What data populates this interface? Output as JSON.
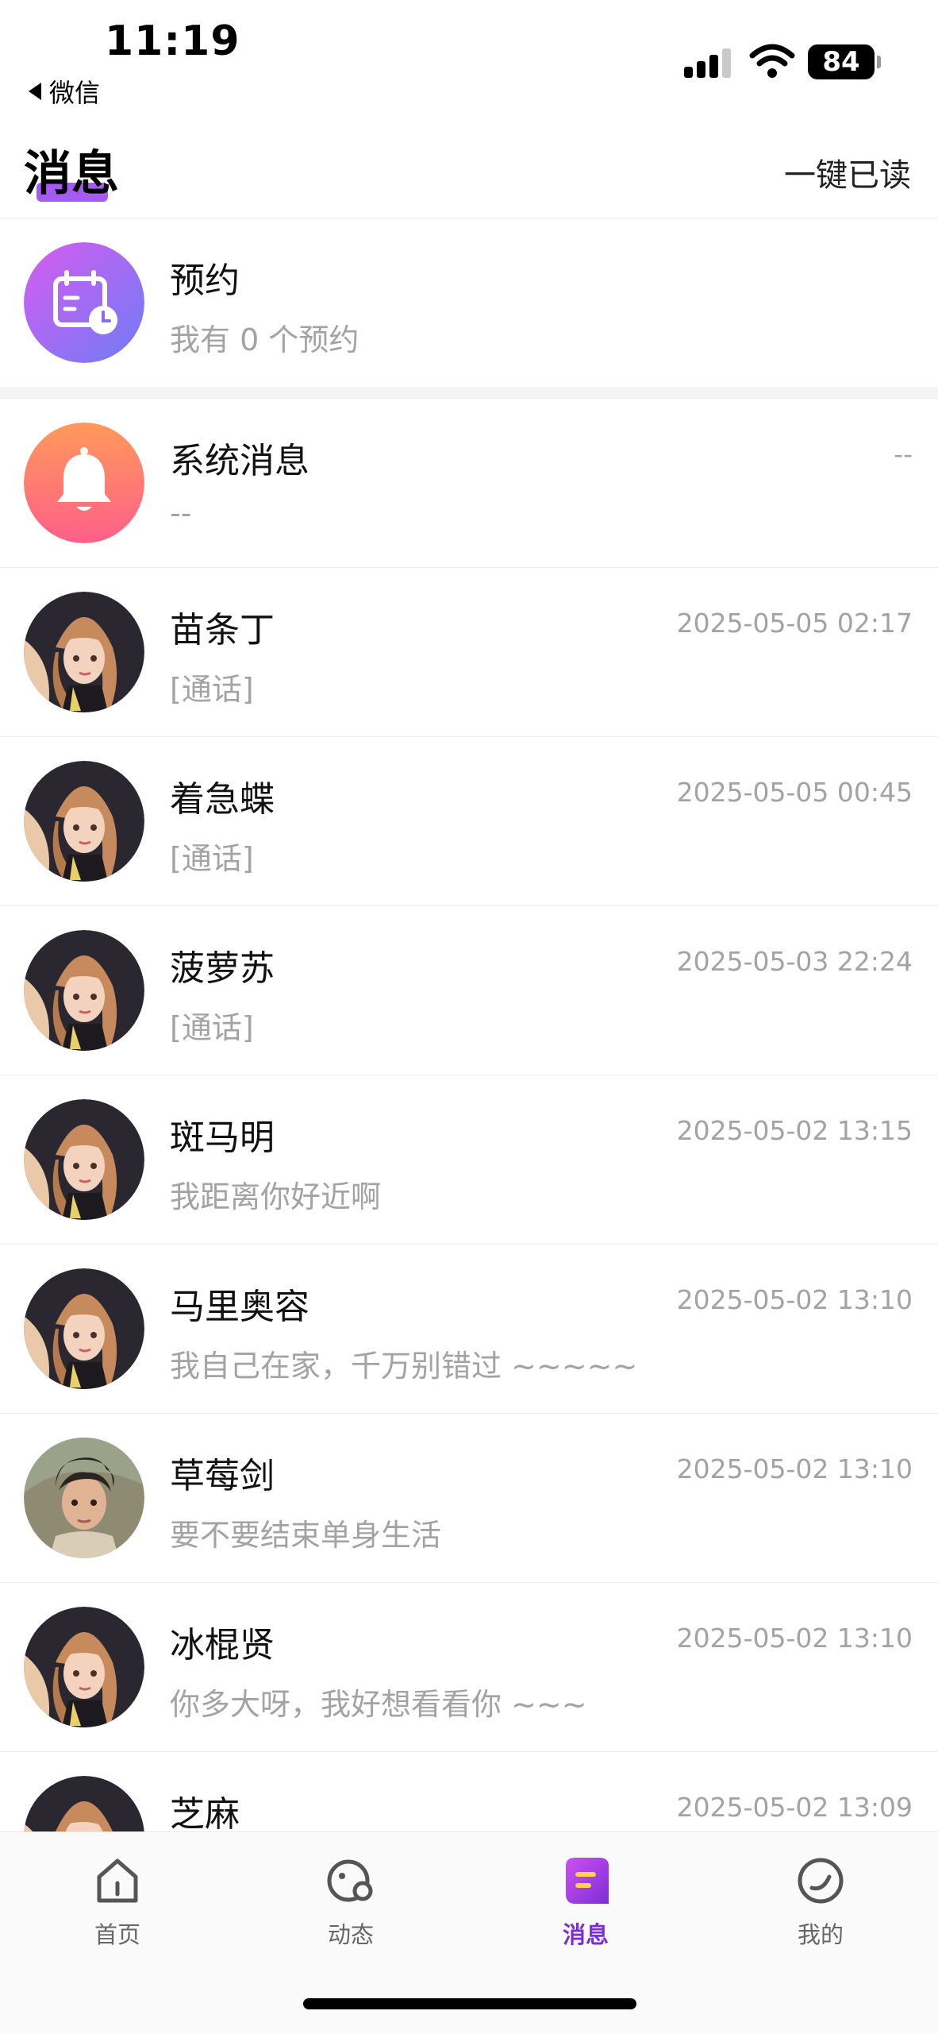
{
  "status_bar": {
    "time": "11:19",
    "back_app": "微信",
    "battery": "84"
  },
  "header": {
    "title": "消息",
    "mark_all_read": "一键已读"
  },
  "appointment": {
    "title": "预约",
    "subtitle": "我有 0 个预约"
  },
  "system": {
    "title": "系统消息",
    "preview": "--",
    "time": "--"
  },
  "conversations": [
    {
      "name": "苗条丁",
      "preview": "[通话]",
      "time": "2025-05-05 02:17"
    },
    {
      "name": "着急蝶",
      "preview": "[通话]",
      "time": "2025-05-05 00:45"
    },
    {
      "name": "菠萝苏",
      "preview": "[通话]",
      "time": "2025-05-03 22:24"
    },
    {
      "name": "斑马明",
      "preview": "我距离你好近啊",
      "time": "2025-05-02 13:15"
    },
    {
      "name": "马里奥容",
      "preview": "我自己在家，千万别错过 ~~~~~",
      "time": "2025-05-02 13:10"
    },
    {
      "name": "草莓剑",
      "preview": "要不要结束单身生活",
      "time": "2025-05-02 13:10"
    },
    {
      "name": "冰棍贤",
      "preview": "你多大呀，我好想看看你 ~~~",
      "time": "2025-05-02 13:10"
    },
    {
      "name": "芝麻",
      "preview": "",
      "time": "2025-05-02 13:09"
    }
  ],
  "nav": {
    "home": "首页",
    "moments": "动态",
    "messages": "消息",
    "mine": "我的"
  },
  "colors": {
    "accent": "#7a2fd6",
    "appointment_gradient": [
      "#d65cf0",
      "#6f7cf6"
    ],
    "system_gradient": [
      "#ff9a5a",
      "#ff5f8a"
    ]
  }
}
